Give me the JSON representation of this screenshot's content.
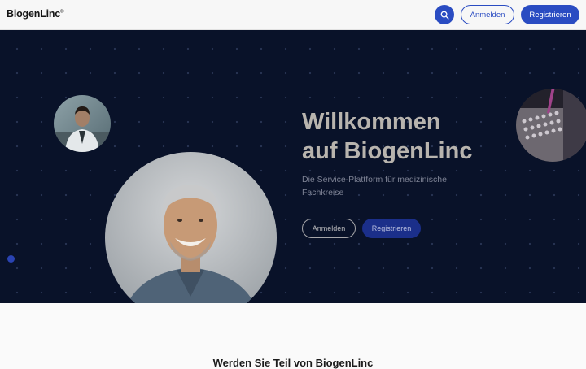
{
  "header": {
    "logo_text": "BiogenLinc",
    "logo_mark": "®",
    "search_icon": "search-icon",
    "login_label": "Anmelden",
    "register_label": "Registrieren"
  },
  "hero": {
    "title_line1": "Willkommen",
    "title_line2": "auf BiogenLinc",
    "subtitle": "Die Service-Plattform für medizinische Fachkreise",
    "login_label": "Anmelden",
    "register_label": "Registrieren"
  },
  "section": {
    "heading": "Werden Sie Teil von BiogenLinc"
  },
  "colors": {
    "accent": "#2a4cc2",
    "hero_background": "#091229"
  }
}
